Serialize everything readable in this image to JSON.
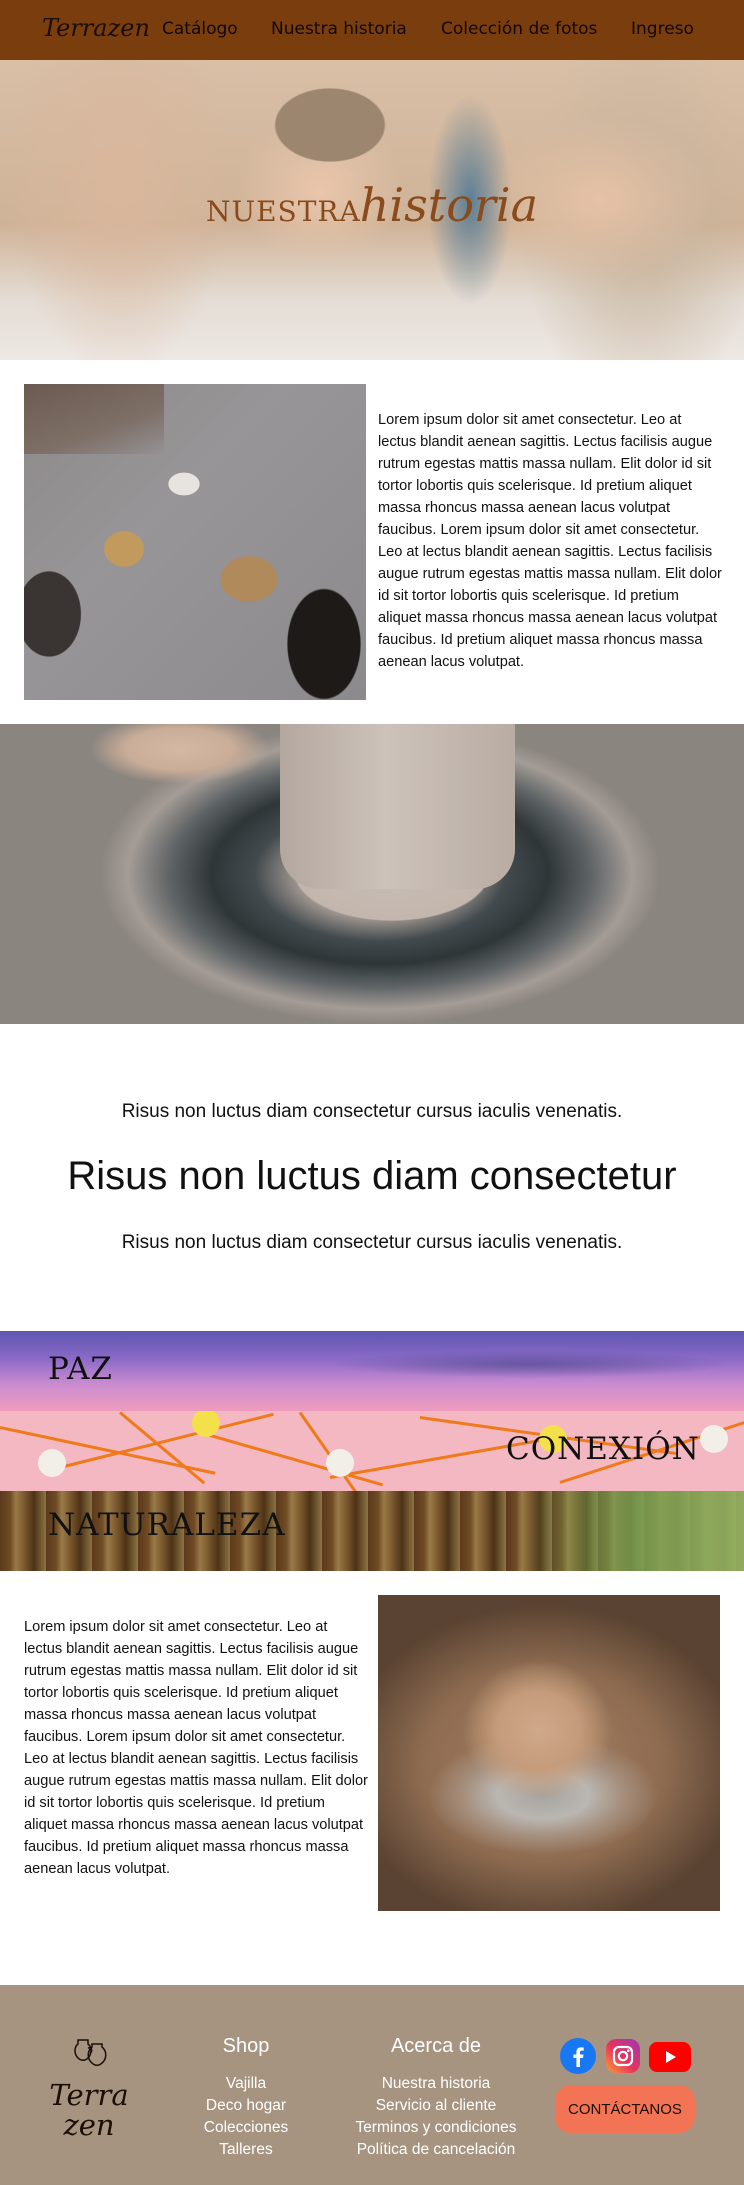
{
  "nav": {
    "logo": "Terrazen",
    "links": [
      "Catálogo",
      "Nuestra historia",
      "Colección de fotos",
      "Ingreso"
    ]
  },
  "hero": {
    "title_plain": "NUESTRA",
    "title_script": "historia"
  },
  "section1": {
    "paragraph": "Lorem ipsum dolor sit amet consectetur. Leo at lectus blandit aenean sagittis. Lectus facilisis augue rutrum egestas mattis massa nullam. Elit dolor id sit tortor lobortis quis scelerisque. Id pretium aliquet massa rhoncus massa aenean lacus volutpat faucibus. Lorem ipsum dolor sit amet consectetur. Leo at lectus blandit aenean sagittis. Lectus facilisis augue rutrum egestas mattis massa nullam. Elit dolor id sit tortor lobortis quis scelerisque. Id pretium aliquet massa rhoncus massa aenean lacus volutpat faucibus. Id pretium aliquet massa rhoncus massa aenean lacus volutpat."
  },
  "taglines": {
    "top": "Risus non luctus diam consectetur cursus iaculis venenatis.",
    "main": "Risus non luctus diam consectetur",
    "bottom": "Risus non luctus diam consectetur cursus iaculis venenatis."
  },
  "bands": {
    "paz": "PAZ",
    "conexion": "CONEXIÓN",
    "naturaleza": "NATURALEZA"
  },
  "section2": {
    "paragraph": "Lorem ipsum dolor sit amet consectetur. Leo at lectus blandit aenean sagittis. Lectus facilisis augue rutrum egestas mattis massa nullam. Elit dolor id sit tortor lobortis quis scelerisque. Id pretium aliquet massa rhoncus massa aenean lacus volutpat faucibus. Lorem ipsum dolor sit amet consectetur. Leo at lectus blandit aenean sagittis. Lectus facilisis augue rutrum egestas mattis massa nullam. Elit dolor id sit tortor lobortis quis scelerisque. Id pretium aliquet massa rhoncus massa aenean lacus volutpat faucibus. Id pretium aliquet massa rhoncus massa aenean lacus volutpat."
  },
  "footer": {
    "logo_top": "Terra",
    "logo_bottom": "zen",
    "shop": {
      "heading": "Shop",
      "links": [
        "Vajilla",
        "Deco hogar",
        "Colecciones",
        "Talleres"
      ]
    },
    "about": {
      "heading": "Acerca de",
      "links": [
        "Nuestra historia",
        "Servicio al cliente",
        "Terminos y condiciones",
        "Política de cancelación"
      ]
    },
    "social_icons": [
      "facebook-icon",
      "instagram-icon",
      "youtube-icon"
    ],
    "contact_label": "CONTÁCTANOS"
  },
  "colors": {
    "nav_bg": "#7a3d0e",
    "hero_title": "#8a4a1c",
    "footer_bg": "#a69480",
    "contact_button": "#f27454"
  }
}
